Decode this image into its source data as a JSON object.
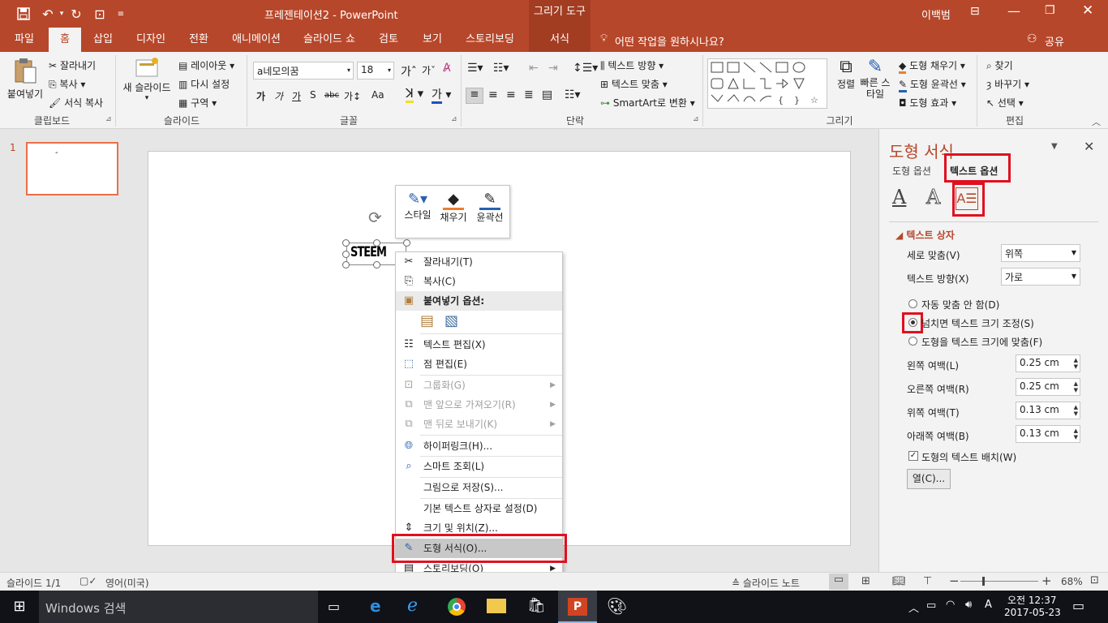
{
  "titlebar": {
    "doc_title": "프레젠테이션2  -  PowerPoint",
    "context_tab": "그리기 도구",
    "user": "이백범"
  },
  "tabs": [
    "파일",
    "홈",
    "삽입",
    "디자인",
    "전환",
    "애니메이션",
    "슬라이드 쇼",
    "검토",
    "보기",
    "스토리보딩",
    "서식"
  ],
  "tell_me": "어떤 작업을 원하시나요?",
  "share": "공유",
  "clipboard": {
    "paste": "붙여넣기",
    "cut": "잘라내기",
    "copy": "복사",
    "format_painter": "서식 복사",
    "group": "클립보드"
  },
  "slides_grp": {
    "new_slide": "새 슬라이드",
    "layout": "레이아웃",
    "reset": "다시 설정",
    "section": "구역",
    "group": "슬라이드"
  },
  "font_grp": {
    "font_name": "a네모의꿈",
    "font_size": "18",
    "group": "글꼴",
    "buttons": [
      "가",
      "가",
      "가",
      "S",
      "abc",
      "가↕",
      "Aa"
    ]
  },
  "para_grp": {
    "text_direction": "텍스트 방향",
    "align_text": "텍스트 맞춤",
    "smartart": "SmartArt로 변환",
    "group": "단락"
  },
  "draw_grp": {
    "arrange": "정렬",
    "quick_styles": "빠른 스타일",
    "fill": "도형 채우기",
    "outline": "도형 윤곽선",
    "effects": "도형 효과",
    "group": "그리기"
  },
  "edit_grp": {
    "find": "찾기",
    "replace": "바꾸기",
    "select": "선택",
    "group": "편집"
  },
  "thumb": {
    "number": "1",
    "text": "-"
  },
  "shape_text": "STEEM",
  "minitoolbar": {
    "style": "스타일",
    "fill": "채우기",
    "outline": "윤곽선"
  },
  "context_menu": {
    "cut": "잘라내기(T)",
    "copy": "복사(C)",
    "paste_options": "붙여넣기 옵션:",
    "edit_text": "텍스트 편집(X)",
    "edit_points": "점 편집(E)",
    "group": "그룹화(G)",
    "bring_front": "맨 앞으로 가져오기(R)",
    "send_back": "맨 뒤로 보내기(K)",
    "hyperlink": "하이퍼링크(H)...",
    "smart_lookup": "스마트 조회(L)",
    "save_as_picture": "그림으로 저장(S)...",
    "set_default": "기본 텍스트 상자로 설정(D)",
    "size_position": "크기 및 위치(Z)...",
    "format_shape": "도형 서식(O)...",
    "storyboard": "스토리보딩(O)"
  },
  "pane": {
    "title": "도형 서식",
    "tab_shape": "도형 옵션",
    "tab_text": "텍스트 옵션",
    "section": "텍스트 상자",
    "valign_label": "세로 맞춤(V)",
    "valign_value": "위쪽",
    "dir_label": "텍스트 방향(X)",
    "dir_value": "가로",
    "opt1": "자동 맞춤 안 함(D)",
    "opt2": "넘치면 텍스트 크기 조정(S)",
    "opt3": "도형을 텍스트 크기에 맞춤(F)",
    "left_label": "왼쪽 여백(L)",
    "left_value": "0.25 cm",
    "right_label": "오른쪽 여백(R)",
    "right_value": "0.25 cm",
    "top_label": "위쪽 여백(T)",
    "top_value": "0.13 cm",
    "bottom_label": "아래쪽 여백(B)",
    "bottom_value": "0.13 cm",
    "wrap_label": "도형의 텍스트 배치(W)",
    "columns_button": "열(C)..."
  },
  "status": {
    "slide": "슬라이드 1/1",
    "lang": "영어(미국)",
    "notes": "슬라이드 노트",
    "zoom": "68%"
  },
  "taskbar": {
    "search": "Windows 검색",
    "time": "오전 12:37",
    "date": "2017-05-23"
  },
  "colors": {
    "accent": "#b7472a",
    "highlight": "#e0101f"
  }
}
